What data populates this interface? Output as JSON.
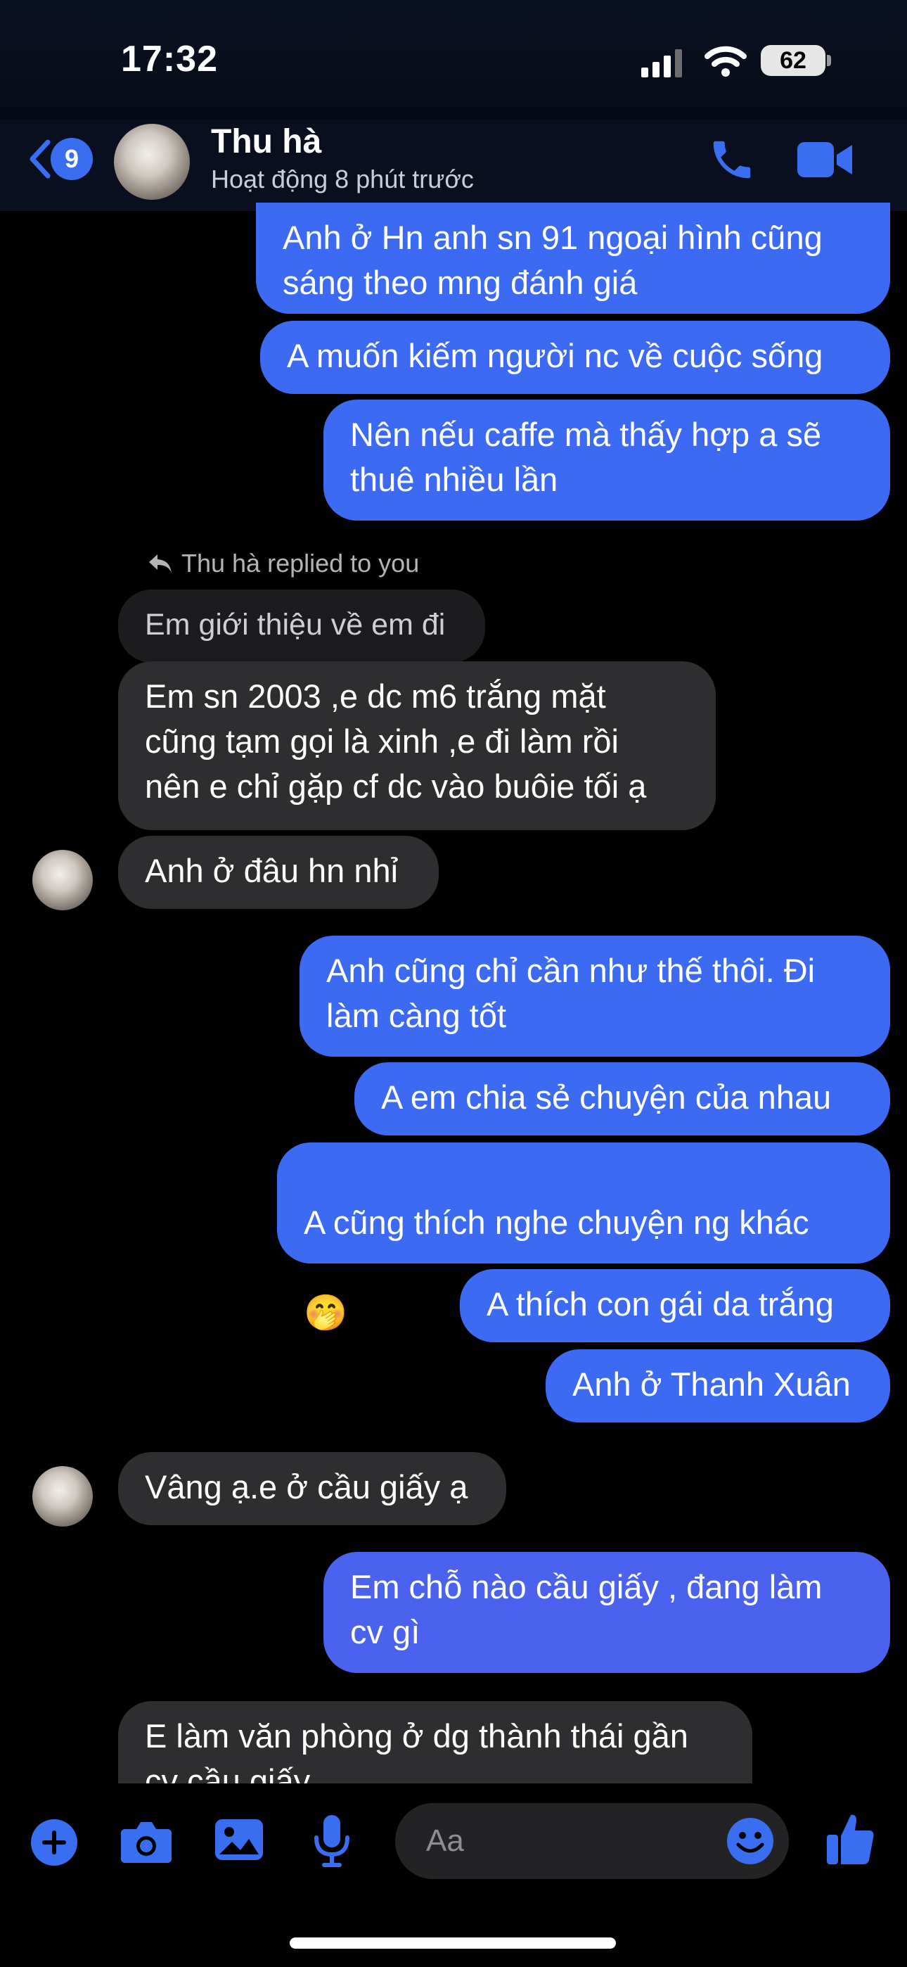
{
  "status_bar": {
    "time": "17:32",
    "battery_level": "62",
    "icons": [
      "signal-icon",
      "wifi-icon",
      "battery-icon"
    ]
  },
  "header": {
    "back_icon": "chevron-left-icon",
    "unread_count": "9",
    "contact_name": "Thu hà",
    "contact_status": "Hoạt động 8 phút trước",
    "actions": [
      "phone-icon",
      "video-camera-icon"
    ]
  },
  "messages": {
    "m1": "Anh ở Hn anh sn 91 ngoại hình cũng\nsáng theo mng đánh giá",
    "m2": "A muốn kiếm người nc về cuộc sống",
    "m3": "Nên nếu caffe mà thấy hợp a sẽ\nthuê nhiều lần",
    "reply_label": "Thu hà replied to you",
    "quoted": "Em giới thiệu về em đi",
    "m4": "Em sn 2003  ,e dc m6 trắng mặt\ncũng tạm gọi là xinh ,e đi làm rồi\nnên e chỉ gặp cf dc vào buôie tối ạ",
    "m5": "Anh ở đâu hn nhỉ",
    "m6": "Anh cũng chỉ cần như thế thôi. Đi\nlàm càng tốt",
    "m7": "A em chia sẻ chuyện của nhau",
    "m8": "A cũng thích nghe chuyện ng khác",
    "m8_emoji": "🤭",
    "m9": "A thích con gái da trắng",
    "m10": "Anh ở Thanh Xuân",
    "m11": "Vâng ạ.e ở cầu giấy ạ",
    "m12": "Em chỗ nào cầu giấy , đang làm\ncv gì",
    "m13": "E làm văn phòng ở dg thành thái gần\ncv cầu giấy"
  },
  "composer": {
    "placeholder": "Aa",
    "icons": [
      "plus-icon",
      "camera-icon",
      "image-icon",
      "microphone-icon",
      "emoji-icon",
      "thumbs-up-icon"
    ]
  },
  "colors": {
    "outgoing_bubble": "#3d6af2",
    "incoming_bubble": "#2e2e30",
    "accent": "#3a6ef0"
  }
}
